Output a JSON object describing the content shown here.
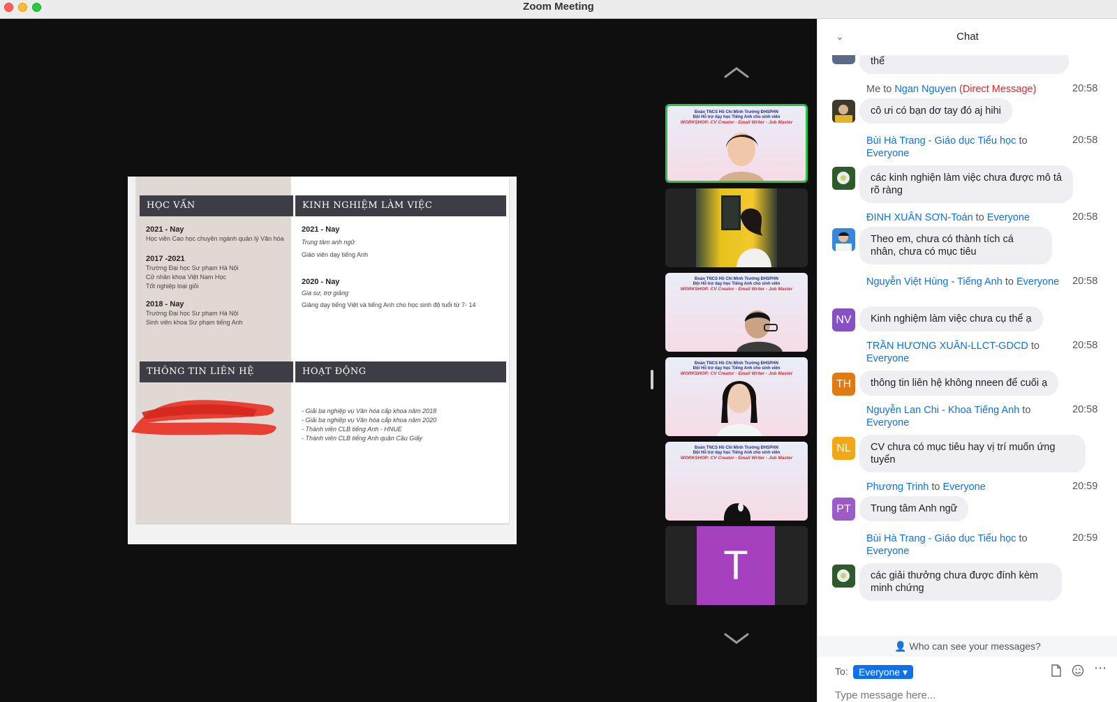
{
  "window": {
    "title": "Zoom Meeting"
  },
  "slide": {
    "sections": {
      "education": "HỌC VẤN",
      "experience": "KINH NGHIỆM LÀM VIỆC",
      "contact": "THÔNG TIN LIÊN HỆ",
      "activities": "HOẠT ĐỘNG"
    },
    "education": [
      {
        "year": "2021 - Nay",
        "lines": [
          "Học viên Cao học chuyên ngành quản lý Văn hóa"
        ]
      },
      {
        "year": "2017 -2021",
        "lines": [
          "Trường Đại học Sư phạm Hà Nội",
          "Cử nhân khoa Việt Nam Học",
          "Tốt nghiệp loại giỏi"
        ]
      },
      {
        "year": "2018 - Nay",
        "lines": [
          "Trường Đại học Sư phạm Hà Nội",
          "Sinh viên khoa Sư phạm tiếng Anh"
        ]
      }
    ],
    "experience": [
      {
        "year": "2021 - Nay",
        "role": "Trung tâm anh ngữ",
        "desc": "Giáo viên dạy tiếng Anh"
      },
      {
        "year": "2020 - Nay",
        "role": "Gia sư, trợ giảng",
        "desc": "Giảng dạy tiếng Việt và tiếng  Anh  cho học sinh độ tuổi  từ 7- 14"
      }
    ],
    "activities": [
      "- Giải ba nghiệp vụ Văn hóa cấp khoa năm 2018",
      "- Giải ba nghiệp vụ Văn hóa cấp khoa năm 2020",
      "- Thành viên CLB tiếng Anh - HNUE",
      "- Thành viên CLB tiếng Anh quận Cầu Giấy"
    ]
  },
  "gallery": {
    "banner": {
      "line1": "Đoàn TNCS Hồ Chí Minh Trường ĐHSPHN",
      "line2": "Đội Hỗ trợ dạy học Tiếng Anh cho sinh viên",
      "line3": "WORKSHOP: CV Creator - Email Writer - Job Master"
    },
    "initial_tile": "T",
    "initial_color": "#a541be"
  },
  "chat": {
    "title": "Chat",
    "partial_bubble": "thể",
    "messages": [
      {
        "prefix": "Me",
        "to_word": "to",
        "sender": "Ngan Nguyen",
        "recipient": "",
        "dm": "(Direct Message)",
        "time": "20:58",
        "avatar": "",
        "avatar_color": "#e4b52c",
        "text": "cô ưi có bạn dơ tay đó aj hihi"
      },
      {
        "prefix": "",
        "to_word": "to",
        "sender": "Bùi Hà Trang - Giáo dục Tiểu học",
        "recipient": "Everyone",
        "dm": "",
        "time": "20:58",
        "avatar": "",
        "avatar_color": "#5f8a4f",
        "text": "các kinh nghiện làm việc chưa được mô tả rõ ràng"
      },
      {
        "prefix": "",
        "to_word": "to",
        "sender": "ĐINH XUÂN SƠN-Toán",
        "recipient": "Everyone",
        "dm": "",
        "time": "20:58",
        "avatar": "",
        "avatar_color": "#2d7fd0",
        "text": "Theo em, chưa có thành tích cá nhân, chưa có mục tiêu"
      },
      {
        "prefix": "",
        "to_word": "to",
        "sender": "Nguyễn Việt Hùng - Tiếng Anh",
        "recipient": "Everyone",
        "dm": "",
        "time": "20:58",
        "avatar": "NV",
        "avatar_color": "#8551c4",
        "text": "Kinh nghiệm làm việc chưa cụ thể ạ"
      },
      {
        "prefix": "",
        "to_word": "to",
        "sender": "TRẦN HƯƠNG XUÂN-LLCT-GDCD",
        "recipient": "Everyone",
        "dm": "",
        "time": "20:58",
        "avatar": "TH",
        "avatar_color": "#e07a13",
        "text": "thông tin liên hệ không nneen để cuối ạ"
      },
      {
        "prefix": "",
        "to_word": "to",
        "sender": "Nguyễn Lan Chi - Khoa Tiếng Anh",
        "recipient": "Everyone",
        "dm": "",
        "time": "20:58",
        "avatar": "NL",
        "avatar_color": "#f0a818",
        "text": "CV chưa có mục tiêu hay vị trí muốn ứng tuyển"
      },
      {
        "prefix": "",
        "to_word": "to",
        "sender": "Phương Trinh",
        "recipient": "Everyone",
        "dm": "",
        "time": "20:59",
        "avatar": "PT",
        "avatar_color": "#9b5cc9",
        "text": "Trung tâm Anh ngữ"
      },
      {
        "prefix": "",
        "to_word": "to",
        "sender": "Bùi Hà Trang - Giáo dục Tiểu học",
        "recipient": "Everyone",
        "dm": "",
        "time": "20:59",
        "avatar": "",
        "avatar_color": "#5f8a4f",
        "text": "các giải thưởng chưa được đính kèm minh chứng"
      }
    ],
    "privacy_note": "Who can see your messages?",
    "to_label": "To:",
    "to_value": "Everyone",
    "input_placeholder": "Type message here..."
  }
}
